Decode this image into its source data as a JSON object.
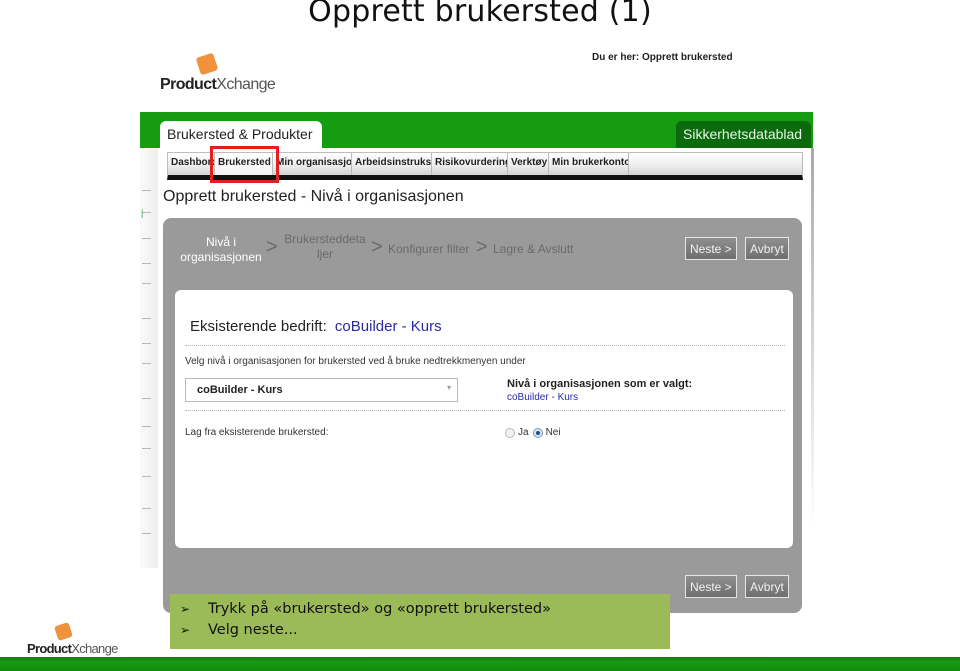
{
  "slide": {
    "title": "Opprett brukersted (1)",
    "instructions": [
      "Trykk på «brukersted» og «opprett brukersted»",
      "Velg neste..."
    ],
    "bullet_icon": "arrowhead-bullet-icon",
    "footer_logo": {
      "bold": "Product",
      "light": "Xchange"
    }
  },
  "app": {
    "logo": {
      "bold": "Product",
      "light": "Xchange"
    },
    "breadcrumb": "Du er her: Opprett brukersted",
    "main_tab": "Brukersted & Produkter",
    "secondary_tab": "Sikkerhetsdatablad",
    "nav_items": [
      {
        "label": "Dashboard",
        "visible_label": "Dashbord"
      },
      {
        "label": "Brukersted",
        "visible_label": "Brukersted",
        "highlighted": true
      },
      {
        "label": "Min organisasjon",
        "visible_label": "Min organisasjon"
      },
      {
        "label": "Arbeidsinstruks",
        "visible_label": "Arbeidsinstruks"
      },
      {
        "label": "Risikovurdering",
        "visible_label": "Risikovurdering"
      },
      {
        "label": "Verktøy",
        "visible_label": "Verktøy"
      },
      {
        "label": "Min brukerkonto",
        "visible_label": "Min brukerkonto"
      }
    ],
    "page_heading": "Opprett brukersted - Nivå i organisasjonen",
    "wizard": {
      "steps": [
        {
          "line1": "Nivå i",
          "line2": "organisasjonen",
          "active": true
        },
        {
          "line1": "Brukersteddeta",
          "line2": "ljer",
          "active": false
        },
        {
          "line1": "Konfigurer filter",
          "line2": "",
          "active": false
        },
        {
          "line1": "Lagre & Avslutt",
          "line2": "",
          "active": false
        }
      ],
      "separator": ">",
      "next_label": "Neste >",
      "cancel_label": "Avbryt"
    },
    "form": {
      "company_label": "Eksisterende bedrift:",
      "company_value": "coBuilder - Kurs",
      "instruction": "Velg nivå i organisasjonen for brukersted ved å bruke nedtrekkmenyen under",
      "dropdown_value": "coBuilder - Kurs",
      "dropdown_arrow": "▾",
      "selected_level_label": "Nivå i organisasjonen som er valgt:",
      "selected_level_value": "coBuilder - Kurs",
      "copy_label": "Lag fra eksisterende brukersted:",
      "radio_options": [
        {
          "label": "Ja",
          "checked": false
        },
        {
          "label": "Nei",
          "checked": true
        }
      ]
    }
  },
  "colors": {
    "brand_green": "#159c11",
    "dark_green_tab": "#0b6a0b",
    "logo_orange": "#f0913c",
    "callout_green": "#9bbb59",
    "highlight_red": "#e01f1f",
    "link_blue": "#2a2aa5",
    "wizard_gray": "#9a9a9a"
  }
}
